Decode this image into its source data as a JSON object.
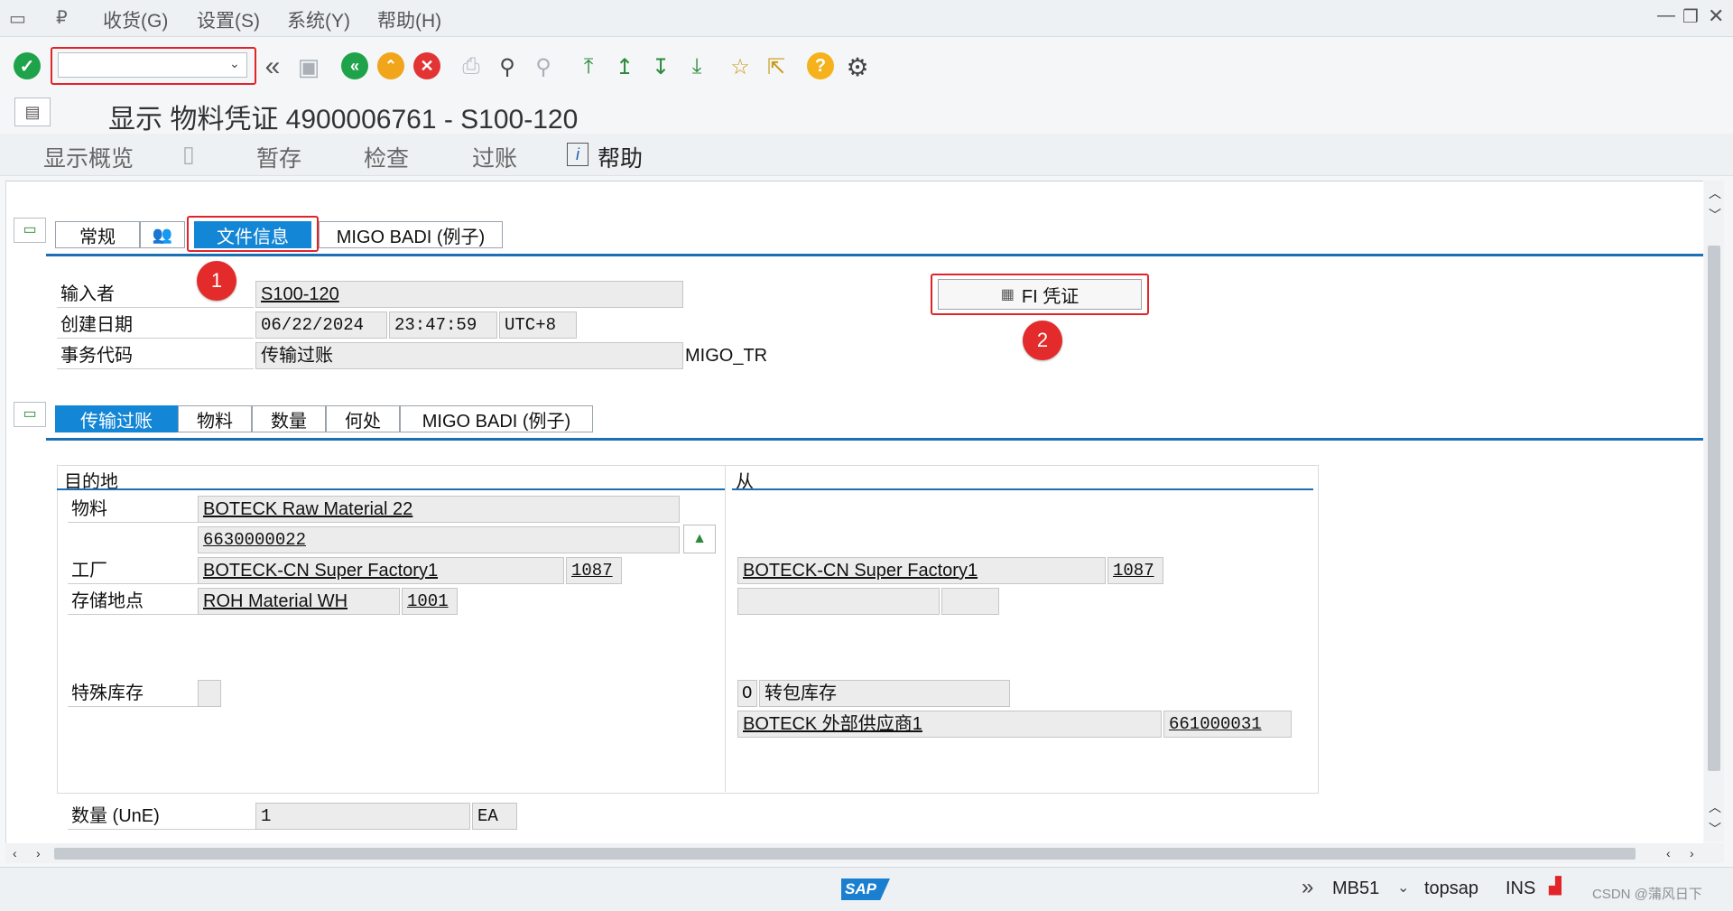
{
  "menu": {
    "items": [
      "收货(G)",
      "设置(S)",
      "系统(Y)",
      "帮助(H)"
    ]
  },
  "toolbar": {
    "command_field_value": "",
    "icons": [
      "check-icon",
      "back-double-icon",
      "save-icon",
      "back-icon",
      "exit-icon",
      "cancel-icon",
      "print-icon",
      "find-icon",
      "find-next-icon",
      "first-page-icon",
      "prev-page-icon",
      "next-page-icon",
      "last-page-icon",
      "new-session-icon",
      "shortcut-icon",
      "help-icon",
      "settings-icon"
    ]
  },
  "title": "显示 物料凭证 4900006761 - S100-120",
  "actions": {
    "overview": "显示概览",
    "hold": "暂存",
    "check": "检查",
    "post": "过账",
    "help": "帮助"
  },
  "header_tabs": [
    "常规",
    "文件信息",
    "MIGO BADI (例子)"
  ],
  "doc_info": {
    "entered_by_label": "输入者",
    "entered_by": "S100-120",
    "created_on_label": "创建日期",
    "created_date": "06/22/2024",
    "created_time": "23:47:59",
    "timezone": "UTC+8",
    "tcode_label": "事务代码",
    "tcode_text": "传输过账",
    "tcode": "MIGO_TR",
    "fi_button": "FI 凭证"
  },
  "markers": [
    "1",
    "2"
  ],
  "item_tabs": [
    "传输过账",
    "物料",
    "数量",
    "何处",
    "MIGO BADI (例子)"
  ],
  "transfer": {
    "dest_title": "目的地",
    "from_title": "从",
    "material_label": "物料",
    "material_desc": "BOTECK Raw Material 22",
    "material_no": "6630000022",
    "plant_label": "工厂",
    "plant_desc": "BOTECK-CN Super Factory1",
    "plant_code": "1087",
    "from_plant_desc": "BOTECK-CN Super Factory1",
    "from_plant_code": "1087",
    "sloc_label": "存储地点",
    "sloc_desc": "ROH Material WH",
    "sloc_code": "1001",
    "special_stock_label": "特殊库存",
    "from_special_code": "O",
    "from_special_text": "转包库存",
    "vendor_desc": "BOTECK 外部供应商1",
    "vendor_code": "661000031"
  },
  "quantity": {
    "label": "数量 (UnE)",
    "value": "1",
    "unit": "EA"
  },
  "status": {
    "tcode": "MB51",
    "server": "topsap",
    "mode": "INS",
    "logo": "SAP",
    "watermark": "CSDN @蒲风日下"
  },
  "colors": {
    "accent": "#1486d6",
    "highlight": "#e0242a",
    "ok": "#1fa34a",
    "nav": "#1fa34a",
    "exit": "#f0a51a",
    "cancel": "#e23434"
  }
}
